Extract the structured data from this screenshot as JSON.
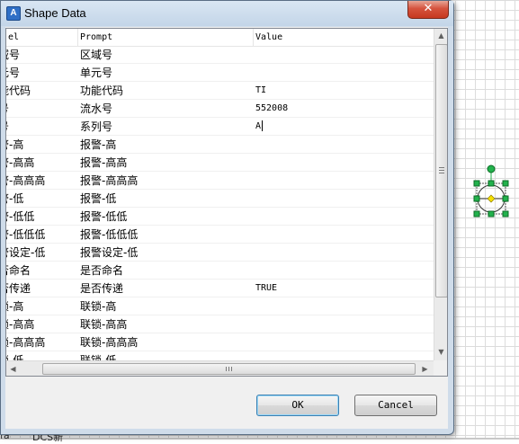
{
  "window": {
    "title": "Shape Data",
    "close_glyph": "✕"
  },
  "table": {
    "columns": [
      "el",
      "Prompt",
      "Value"
    ],
    "rows": [
      {
        "label": "域号",
        "prompt": "区域号",
        "value": ""
      },
      {
        "label": "元号",
        "prompt": "单元号",
        "value": ""
      },
      {
        "label": "能代码",
        "prompt": "功能代码",
        "value": "TI"
      },
      {
        "label": "号",
        "prompt": "流水号",
        "value": "552008"
      },
      {
        "label": "号",
        "prompt": "系列号",
        "value": "A"
      },
      {
        "label": "警-高",
        "prompt": "报警-高",
        "value": ""
      },
      {
        "label": "警-高高",
        "prompt": "报警-高高",
        "value": ""
      },
      {
        "label": "警-高高高",
        "prompt": "报警-高高高",
        "value": ""
      },
      {
        "label": "警-低",
        "prompt": "报警-低",
        "value": ""
      },
      {
        "label": "警-低低",
        "prompt": "报警-低低",
        "value": ""
      },
      {
        "label": "警-低低低",
        "prompt": "报警-低低低",
        "value": ""
      },
      {
        "label": "警设定-低",
        "prompt": "报警设定-低",
        "value": ""
      },
      {
        "label": "否命名",
        "prompt": "是否命名",
        "value": ""
      },
      {
        "label": "否传递",
        "prompt": "是否传递",
        "value": "TRUE"
      },
      {
        "label": "锁-高",
        "prompt": "联锁-高",
        "value": ""
      },
      {
        "label": "锁-高高",
        "prompt": "联锁-高高",
        "value": ""
      },
      {
        "label": "锁-高高高",
        "prompt": "联锁-高高高",
        "value": ""
      },
      {
        "label": "锁-低",
        "prompt": "联锁-低",
        "value": ""
      }
    ]
  },
  "buttons": {
    "ok": "OK",
    "cancel": "Cancel"
  },
  "background": {
    "bottom_labels": [
      "fa",
      "DCS新"
    ]
  },
  "colors": {
    "accent": "#3c7fb1",
    "close": "#c6381f",
    "shape_handle": "#22b24c",
    "shape_handle_center": "#f5e000"
  },
  "icons": {
    "app": "A"
  }
}
